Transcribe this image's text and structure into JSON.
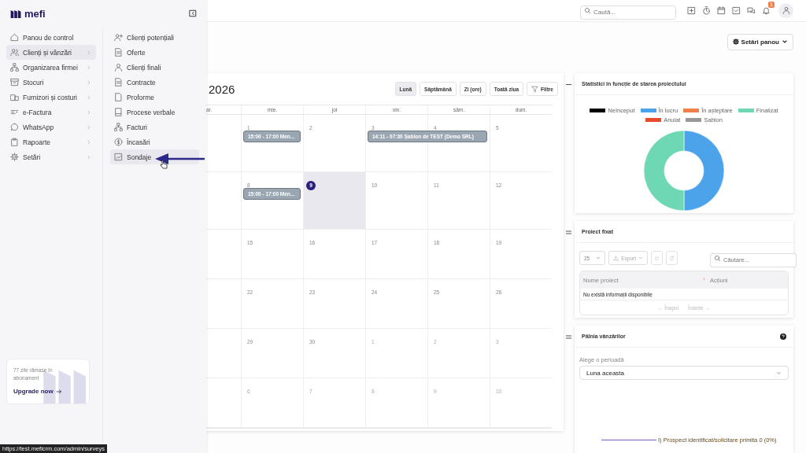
{
  "sidebar": {
    "logo": "mefi",
    "menu": [
      {
        "label": "Panou de control",
        "selected": false,
        "expandable": false
      },
      {
        "label": "Clienți și vânzări",
        "selected": true,
        "expandable": true
      },
      {
        "label": "Organizarea firmei",
        "selected": false,
        "expandable": true
      },
      {
        "label": "Stocuri",
        "selected": false,
        "expandable": true
      },
      {
        "label": "Furnizori și costuri",
        "selected": false,
        "expandable": true
      },
      {
        "label": "e-Factura",
        "selected": false,
        "expandable": true
      },
      {
        "label": "WhatsApp",
        "selected": false,
        "expandable": true
      },
      {
        "label": "Rapoarte",
        "selected": false,
        "expandable": true
      },
      {
        "label": "Setări",
        "selected": false,
        "expandable": true
      }
    ],
    "submenu": [
      {
        "label": "Clienți potențiali",
        "selected": false
      },
      {
        "label": "Oferte",
        "selected": false
      },
      {
        "label": "Clienți finali",
        "selected": false
      },
      {
        "label": "Contracte",
        "selected": false
      },
      {
        "label": "Proforme",
        "selected": false
      },
      {
        "label": "Procese verbale",
        "selected": false
      },
      {
        "label": "Facturi",
        "selected": false
      },
      {
        "label": "Încasări",
        "selected": false
      },
      {
        "label": "Sondaje",
        "selected": true
      }
    ],
    "upgrade": {
      "text": "77 zile rămase în abonament",
      "link": "Upgrade now"
    }
  },
  "topbar": {
    "search": {
      "placeholder": "Caută..."
    },
    "notification_badge": "1"
  },
  "settings_button": {
    "label": "Setări panou"
  },
  "calendar": {
    "title": "2026",
    "views": [
      {
        "label": "Lună",
        "selected": true
      },
      {
        "label": "Săptămână",
        "selected": false
      },
      {
        "label": "Zi (ore)",
        "selected": false
      },
      {
        "label": "Toată ziua",
        "selected": false
      }
    ],
    "filter": "Filtre",
    "weekdays": [
      "ar.",
      "mie.",
      "joi",
      "vin.",
      "sâm.",
      "dum."
    ],
    "weeks": [
      [
        {
          "day": "1",
          "muted": false,
          "today": false,
          "events": [
            {
              "text": "15:00 - 17:00 Men...",
              "continues": false
            }
          ]
        },
        {
          "day": "2",
          "muted": false,
          "today": false
        },
        {
          "day": "3",
          "muted": false,
          "today": false,
          "events": [
            {
              "text": "14:11 - 07:30 Șablon de TEST (Demo SRL)",
              "continues": true
            }
          ]
        },
        {
          "day": "4",
          "muted": false,
          "today": false
        },
        {
          "day": "5",
          "muted": false,
          "today": false
        }
      ],
      [
        {
          "day": "8",
          "muted": false,
          "today": false,
          "events": [
            {
              "text": "15:00 - 17:00 Men...",
              "continues": false
            }
          ]
        },
        {
          "day": "9",
          "muted": false,
          "today": true
        },
        {
          "day": "10",
          "muted": false,
          "today": false
        },
        {
          "day": "11",
          "muted": false,
          "today": false
        },
        {
          "day": "12",
          "muted": false,
          "today": false
        }
      ],
      [
        {
          "day": "15",
          "muted": false,
          "today": false
        },
        {
          "day": "16",
          "muted": false,
          "today": false
        },
        {
          "day": "17",
          "muted": false,
          "today": false
        },
        {
          "day": "18",
          "muted": false,
          "today": false
        },
        {
          "day": "19",
          "muted": false,
          "today": false
        }
      ],
      [
        {
          "day": "22",
          "muted": false,
          "today": false
        },
        {
          "day": "23",
          "muted": false,
          "today": false
        },
        {
          "day": "24",
          "muted": false,
          "today": false
        },
        {
          "day": "25",
          "muted": false,
          "today": false
        },
        {
          "day": "26",
          "muted": false,
          "today": false
        }
      ],
      [
        {
          "day": "29",
          "muted": false,
          "today": false
        },
        {
          "day": "30",
          "muted": false,
          "today": false
        },
        {
          "day": "1",
          "muted": true,
          "today": false
        },
        {
          "day": "2",
          "muted": true,
          "today": false
        },
        {
          "day": "3",
          "muted": true,
          "today": false
        }
      ],
      [
        {
          "day": "6",
          "muted": true,
          "today": false
        },
        {
          "day": "7",
          "muted": true,
          "today": false
        },
        {
          "day": "8",
          "muted": true,
          "today": false
        },
        {
          "day": "9",
          "muted": true,
          "today": false
        },
        {
          "day": "10",
          "muted": true,
          "today": false
        }
      ]
    ]
  },
  "stats_card": {
    "title": "Statistici în funcție de starea proiectului",
    "chart_data": {
      "type": "donut",
      "categories": [
        "Neînceput",
        "În lucru",
        "În așteptare",
        "Finalizat",
        "Anulat",
        "Șablon"
      ],
      "colors": [
        "#000000",
        "#4da3ea",
        "#f0804a",
        "#6dd8b3",
        "#e84a2e",
        "#999999"
      ],
      "values": [
        0,
        50,
        0,
        50,
        0,
        0
      ]
    }
  },
  "project_card": {
    "title": "Proiect fixat",
    "per_page": "25",
    "export": "Export",
    "search": {
      "placeholder": "Căutare..."
    },
    "columns": [
      "Nume proiect",
      "Acțiuni"
    ],
    "empty_text": "Nu există informații disponibile",
    "pagination": {
      "previous": "← Înapoi",
      "next": "Înainte →",
      "disabled": true
    }
  },
  "funnel_card": {
    "title": "Pâlnia vânzărilor",
    "period_label": "Alege o perioadă",
    "period": "Luna aceasta",
    "funnel_label": "I) Prospect identificat/solicitare primita 0 (0%)"
  },
  "status_url": "https://test.meficrm.com/admin/surveys"
}
